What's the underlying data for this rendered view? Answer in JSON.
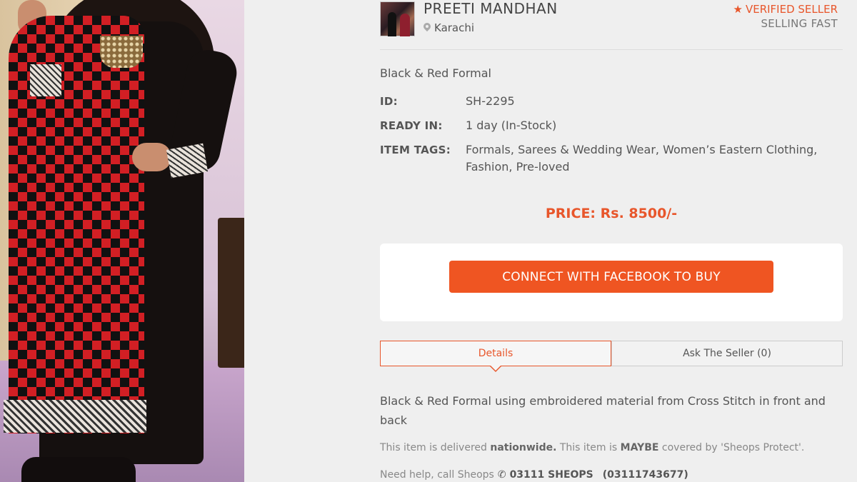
{
  "seller": {
    "name": "PREETI MANDHAN",
    "location": "Karachi",
    "verified": "VERIFIED SELLER",
    "status": "SELLING FAST"
  },
  "product": {
    "title": "Black & Red Formal",
    "id_label": "ID:",
    "id_value": "SH-2295",
    "ready_label": "READY IN:",
    "ready_value": "1 day (In-Stock)",
    "tags_label": "ITEM TAGS:",
    "tags_value": "Formals, Sarees & Wedding Wear, Women’s Eastern Clothing, Fashion, Pre-loved",
    "price": "PRICE: Rs. 8500/-"
  },
  "actions": {
    "buy_button": "CONNECT WITH FACEBOOK TO BUY"
  },
  "tabs": [
    {
      "label": "Details"
    },
    {
      "label": "Ask The Seller (0)"
    }
  ],
  "details": {
    "description": "Black & Red Formal using embroidered material from Cross Stitch in front and back",
    "delivery_1": "This item is delivered ",
    "delivery_bold_1": "nationwide.",
    "delivery_2": " This item is ",
    "delivery_bold_2": "MAYBE",
    "delivery_3": " covered by 'Sheops Protect'.",
    "help_text": "Need help, call Sheops",
    "help_phone": "03111 SHEOPS",
    "help_number": "(03111743677)"
  },
  "icons": {
    "pin": "map-pin-icon",
    "star": "star-icon",
    "phone": "phone-icon"
  },
  "colors": {
    "accent": "#e8562b",
    "button": "#ef5522"
  }
}
